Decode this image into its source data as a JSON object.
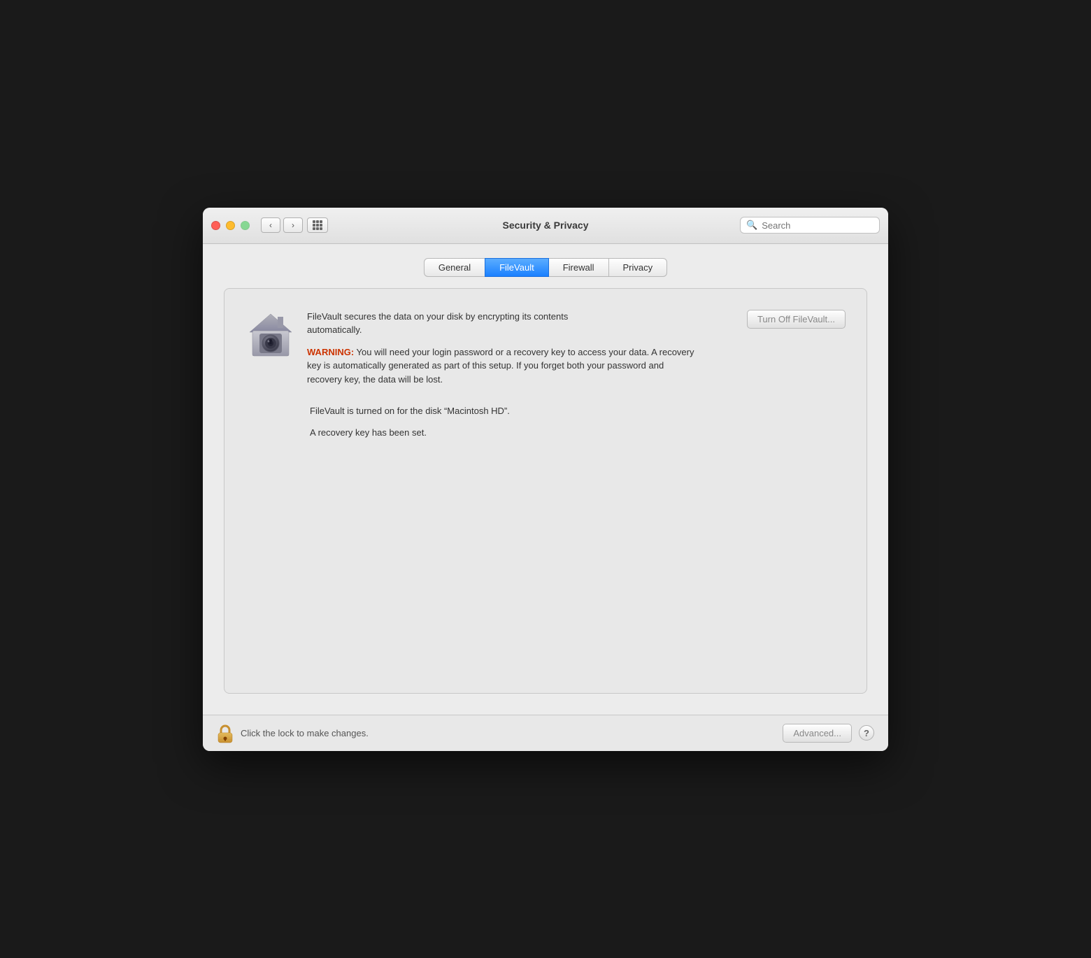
{
  "window": {
    "title": "Security & Privacy"
  },
  "titlebar": {
    "nav_back": "‹",
    "nav_forward": "›"
  },
  "search": {
    "placeholder": "Search"
  },
  "tabs": [
    {
      "id": "general",
      "label": "General",
      "active": false
    },
    {
      "id": "filevault",
      "label": "FileVault",
      "active": true
    },
    {
      "id": "firewall",
      "label": "Firewall",
      "active": false
    },
    {
      "id": "privacy",
      "label": "Privacy",
      "active": false
    }
  ],
  "filevault": {
    "description": "FileVault secures the data on your disk by encrypting its contents automatically.",
    "warning_label": "WARNING:",
    "warning_text": " You will need your login password or a recovery key to access your data. A recovery key is automatically generated as part of this setup. If you forget both your password and recovery key, the data will be lost.",
    "turn_off_button": "Turn Off FileVault...",
    "status_text": "FileVault is turned on for the disk “Macintosh HD”.",
    "recovery_text": "A recovery key has been set."
  },
  "bottom_bar": {
    "lock_label": "Click the lock to make changes.",
    "advanced_button": "Advanced...",
    "help_button": "?"
  }
}
